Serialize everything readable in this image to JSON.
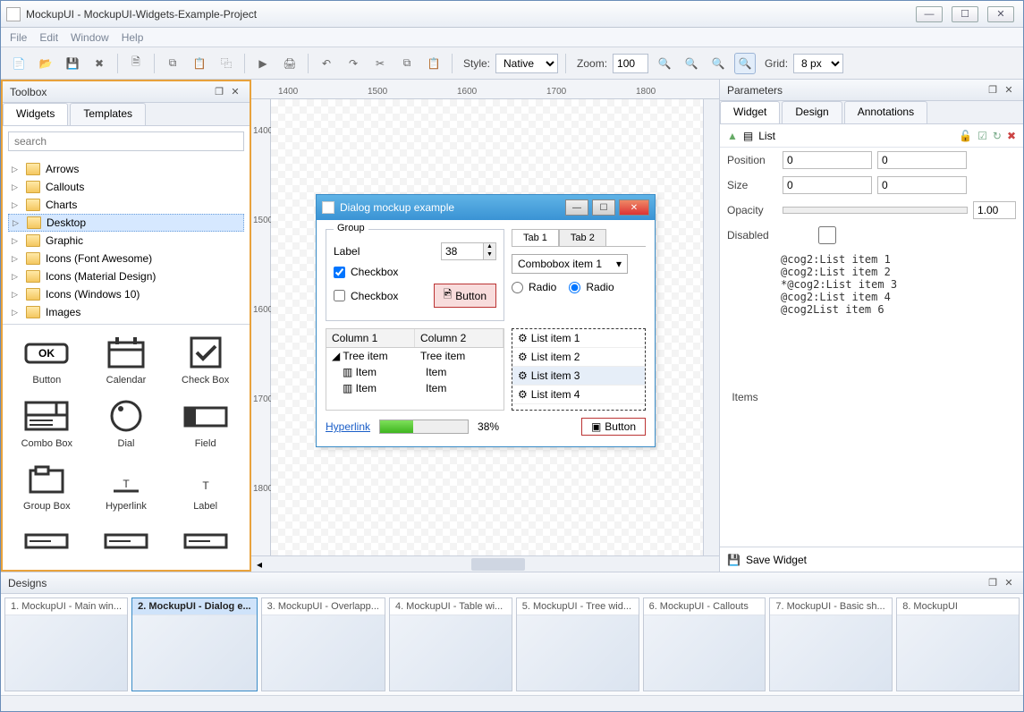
{
  "titlebar": {
    "text": "MockupUI - MockupUI-Widgets-Example-Project"
  },
  "menu": [
    "File",
    "Edit",
    "Window",
    "Help"
  ],
  "toolbar": {
    "style_label": "Style:",
    "style_value": "Native",
    "zoom_label": "Zoom:",
    "zoom_value": "100",
    "grid_label": "Grid:",
    "grid_value": "8 px"
  },
  "toolbox": {
    "title": "Toolbox",
    "tabs": [
      "Widgets",
      "Templates"
    ],
    "search_placeholder": "search",
    "folders": [
      "Arrows",
      "Callouts",
      "Charts",
      "Desktop",
      "Graphic",
      "Icons (Font Awesome)",
      "Icons (Material Design)",
      "Icons (Windows 10)",
      "Images"
    ],
    "selected_folder": 3,
    "widgets": [
      "Button",
      "Calendar",
      "Check Box",
      "Combo Box",
      "Dial",
      "Field",
      "Group Box",
      "Hyperlink",
      "Label"
    ]
  },
  "ruler_h": [
    "1400",
    "1500",
    "1600",
    "1700",
    "1800"
  ],
  "ruler_v": [
    "1400",
    "1500",
    "1600",
    "1700",
    "1800"
  ],
  "dialog": {
    "title": "Dialog mockup example",
    "group_legend": "Group",
    "label": "Label",
    "spin_value": "38",
    "checkbox1": "Checkbox",
    "checkbox2": "Checkbox",
    "button": "Button",
    "tab1": "Tab 1",
    "tab2": "Tab 2",
    "combo": "Combobox item 1",
    "radio1": "Radio",
    "radio2": "Radio",
    "col1": "Column 1",
    "col2": "Column 2",
    "tree_root": "Tree item",
    "tree_root2": "Tree item",
    "tree_item": "Item",
    "list": [
      "List item 1",
      "List item 2",
      "List item 3",
      "List item 4"
    ],
    "hyperlink": "Hyperlink",
    "progress_pct": "38%",
    "button2": "Button"
  },
  "params": {
    "title": "Parameters",
    "tabs": [
      "Widget",
      "Design",
      "Annotations"
    ],
    "widget_name": "List",
    "position_label": "Position",
    "position_x": "0",
    "position_y": "0",
    "size_label": "Size",
    "size_w": "0",
    "size_h": "0",
    "opacity_label": "Opacity",
    "opacity_value": "1.00",
    "disabled_label": "Disabled",
    "items_label": "Items",
    "items_text": "@cog2:List item 1\n@cog2:List item 2\n*@cog2:List item 3\n@cog2:List item 4\n@cog2List item 6",
    "save": "Save Widget"
  },
  "designs": {
    "title": "Designs",
    "cards": [
      "1. MockupUI - Main win...",
      "2. MockupUI - Dialog e...",
      "3. MockupUI - Overlapp...",
      "4. MockupUI - Table wi...",
      "5. MockupUI - Tree wid...",
      "6. MockupUI - Callouts",
      "7. MockupUI - Basic sh...",
      "8. MockupUI"
    ],
    "active": 1
  }
}
